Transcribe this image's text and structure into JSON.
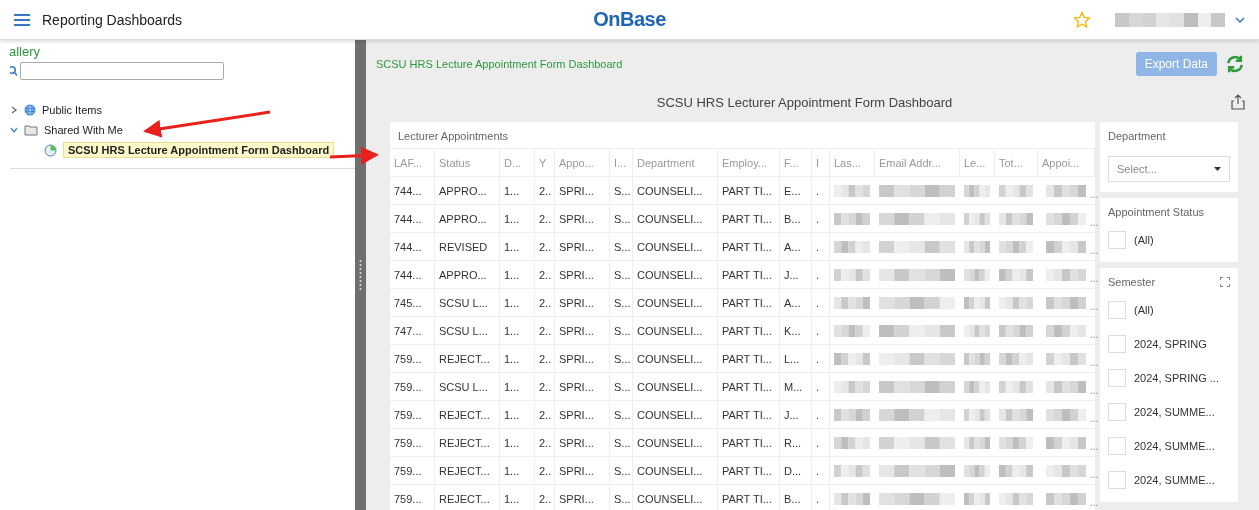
{
  "header": {
    "title": "Reporting Dashboards",
    "logo": "OnBase",
    "favorite": false
  },
  "sidebar": {
    "heading": "allery",
    "tree": [
      {
        "label": "Public Items",
        "expanded": false,
        "kind": "globe",
        "selected": false
      },
      {
        "label": "Shared With Me",
        "expanded": true,
        "kind": "folder",
        "selected": false,
        "children": [
          {
            "label": "SCSU HRS Lecture Appointment Form Dashboard",
            "kind": "dashboard",
            "selected": true
          }
        ]
      }
    ]
  },
  "breadcrumb": "SCSU HRS Lecture Appointment Form Dashboard",
  "export_button": "Export Data",
  "dashboard_title": "SCSU HRS Lecturer Appointment Form Dashboard",
  "table": {
    "title": "Lecturer Appointments",
    "columns": [
      "LAF...",
      "Status",
      "D...",
      "Y",
      "Appo...",
      "I...",
      "Department",
      "Employ...",
      "F...",
      "I",
      "Las...",
      "Email Addr...",
      "Le...",
      "Tot...",
      "Appoi..."
    ],
    "rows": [
      [
        "744...",
        "APPRO...",
        "1...",
        "2..",
        "SPRI...",
        "S...",
        "COUNSELI...",
        "PART TI...",
        "E...",
        "."
      ],
      [
        "744...",
        "APPRO...",
        "1...",
        "2..",
        "SPRI...",
        "S...",
        "COUNSELI...",
        "PART TI...",
        "B...",
        "."
      ],
      [
        "744...",
        "REVISED",
        "1...",
        "2..",
        "SPRI...",
        "S...",
        "COUNSELI...",
        "PART TI...",
        "A...",
        "."
      ],
      [
        "744...",
        "APPRO...",
        "1...",
        "2..",
        "SPRI...",
        "S...",
        "COUNSELI...",
        "PART TI...",
        "J...",
        "."
      ],
      [
        "745...",
        "SCSU L...",
        "1...",
        "2..",
        "SPRI...",
        "S...",
        "COUNSELI...",
        "PART TI...",
        "A...",
        "."
      ],
      [
        "747...",
        "SCSU L...",
        "1...",
        "2..",
        "SPRI...",
        "S...",
        "COUNSELI...",
        "PART TI...",
        "K...",
        "."
      ],
      [
        "759...",
        "REJECT...",
        "1...",
        "2..",
        "SPRI...",
        "S...",
        "COUNSELI...",
        "PART TI...",
        "L...",
        "."
      ],
      [
        "759...",
        "SCSU L...",
        "1...",
        "2..",
        "SPRI...",
        "S...",
        "COUNSELI...",
        "PART TI...",
        "M...",
        "."
      ],
      [
        "759...",
        "REJECT...",
        "1...",
        "2..",
        "SPRI...",
        "S...",
        "COUNSELI...",
        "PART TI...",
        "J...",
        "."
      ],
      [
        "759...",
        "REJECT...",
        "1...",
        "2..",
        "SPRI...",
        "S...",
        "COUNSELI...",
        "PART TI...",
        "R...",
        "."
      ],
      [
        "759...",
        "REJECT...",
        "1...",
        "2..",
        "SPRI...",
        "S...",
        "COUNSELI...",
        "PART TI...",
        "D...",
        "."
      ],
      [
        "759...",
        "REJECT...",
        "1...",
        "2..",
        "SPRI...",
        "S...",
        "COUNSELI...",
        "PART TI...",
        "B...",
        "."
      ]
    ],
    "row_tail": "..."
  },
  "filters": [
    {
      "kind": "select",
      "title": "Department",
      "placeholder": "Select..."
    },
    {
      "kind": "checklist",
      "title": "Appointment Status",
      "options": [
        {
          "label": "(All)",
          "checked": false
        }
      ]
    },
    {
      "kind": "checklist",
      "title": "Semester",
      "expandable": true,
      "options": [
        {
          "label": "(All)",
          "checked": false
        },
        {
          "label": "2024, SPRING",
          "checked": false
        },
        {
          "label": "2024, SPRING ...",
          "checked": false
        },
        {
          "label": "2024, SUMME...",
          "checked": false
        },
        {
          "label": "2024, SUMME...",
          "checked": false
        },
        {
          "label": "2024, SUMME...",
          "checked": false
        }
      ]
    }
  ]
}
